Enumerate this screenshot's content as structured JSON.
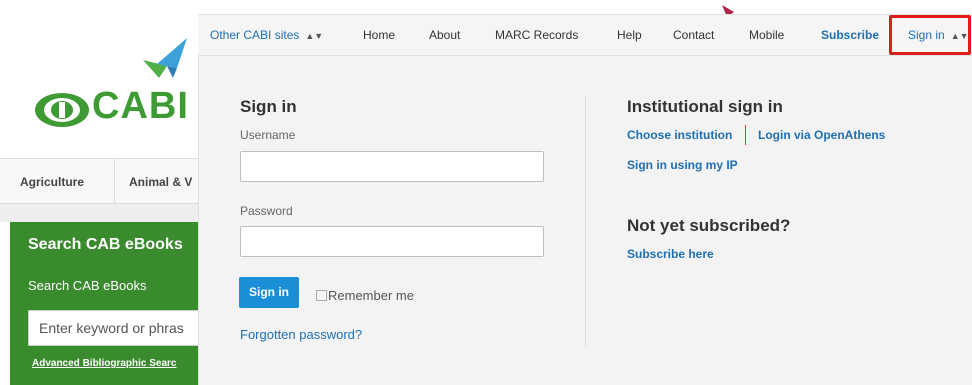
{
  "logo": {
    "brand_text": "CABI",
    "brand_color": "#3e9a32"
  },
  "category_nav": {
    "items": [
      "Agriculture",
      "Animal & V"
    ]
  },
  "search_panel": {
    "title": "Search CAB eBooks",
    "subtitle": "Search CAB eBooks",
    "input_placeholder": "Enter keyword or phras",
    "advanced_link": "Advanced Bibliographic Searc",
    "panel_color": "#3a8a2e"
  },
  "topbar": {
    "other_sites": "Other CABI sites",
    "items": [
      "Home",
      "About",
      "MARC Records",
      "Help",
      "Contact",
      "Mobile"
    ],
    "subscribe": "Subscribe",
    "sign_in": "Sign in",
    "highlight_color": "#e01c1c"
  },
  "signin_form": {
    "heading": "Sign in",
    "username_label": "Username",
    "username_value": "",
    "password_label": "Password",
    "password_value": "",
    "submit_label": "Sign in",
    "remember_label": "Remember me",
    "remember_checked": false,
    "forgot_link": "Forgotten password?",
    "button_color": "#1a8fd8"
  },
  "institutional": {
    "heading": "Institutional sign in",
    "choose_institution": "Choose institution",
    "openathens": "Login via OpenAthens",
    "my_ip": "Sign in using my IP"
  },
  "not_subscribed": {
    "heading": "Not yet subscribed?",
    "subscribe_link": "Subscribe here"
  }
}
